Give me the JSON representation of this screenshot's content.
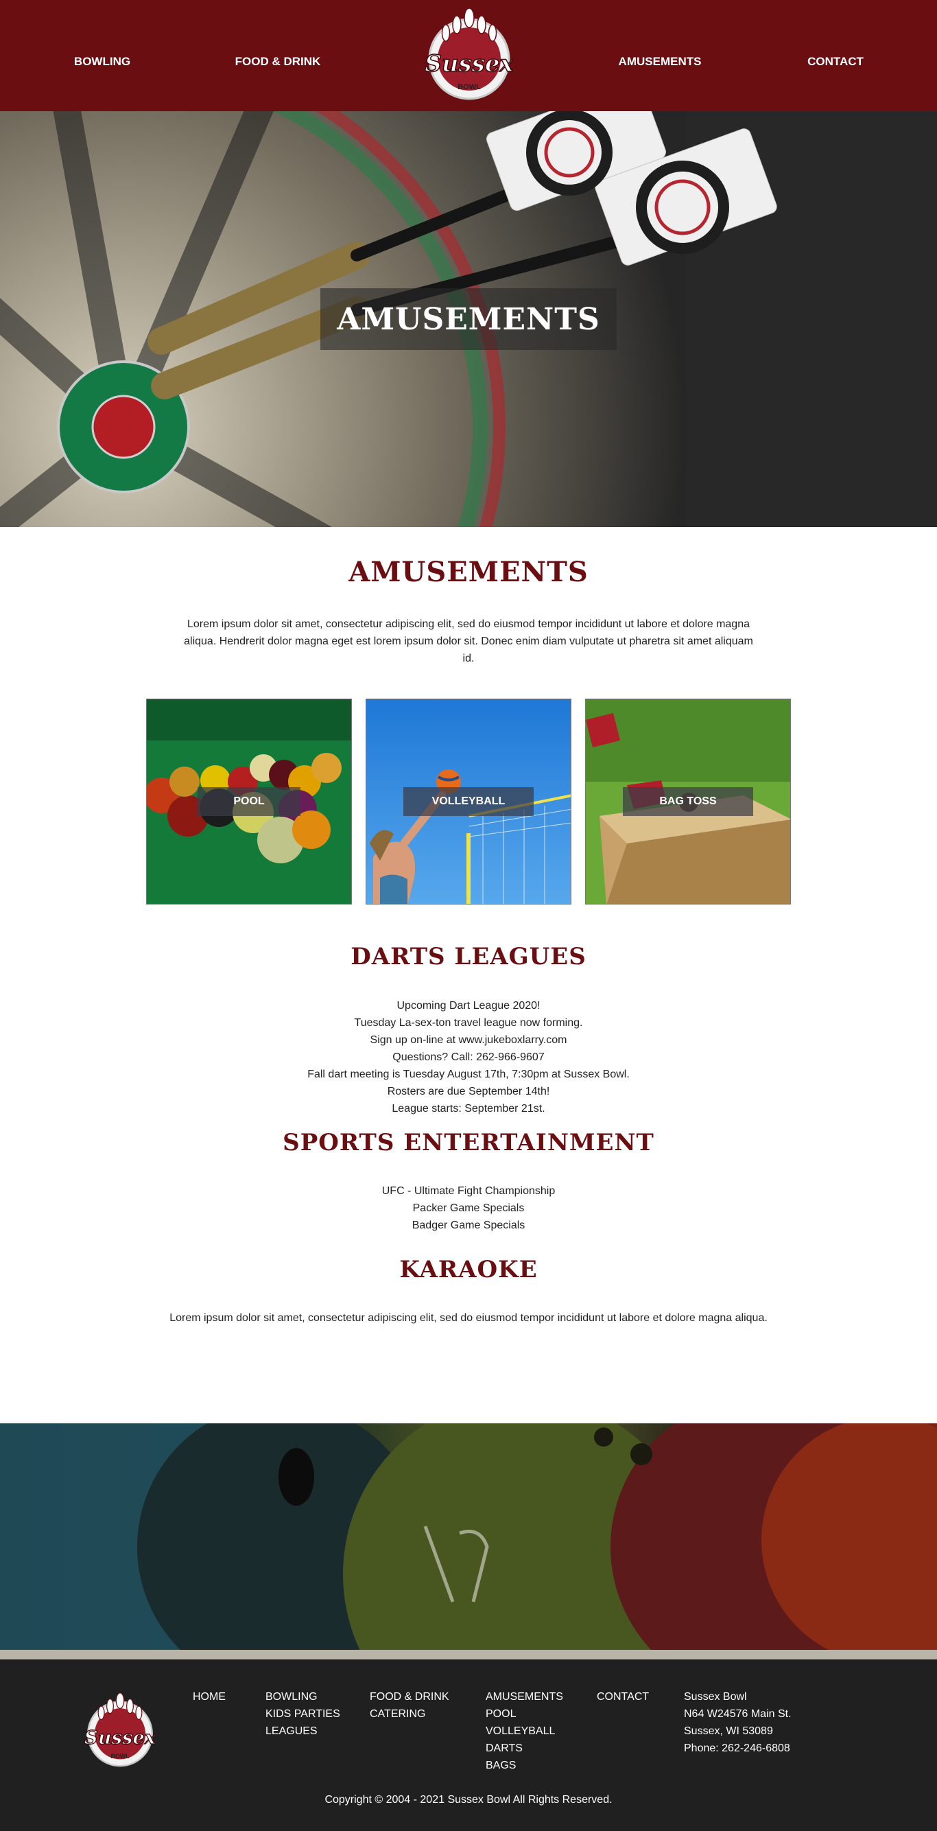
{
  "nav": {
    "bowling": "BOWLING",
    "food_drink": "FOOD & DRINK",
    "amusements": "AMUSEMENTS",
    "contact": "CONTACT"
  },
  "logo": {
    "name": "Sussex",
    "sub": "BOWL"
  },
  "hero": {
    "title": "AMUSEMENTS"
  },
  "intro": {
    "title": "AMUSEMENTS",
    "text": "Lorem ipsum dolor sit amet, consectetur adipiscing elit, sed do eiusmod tempor incididunt ut labore et dolore magna aliqua. Hendrerit dolor magna eget est lorem ipsum dolor sit. Donec enim diam vulputate ut pharetra sit amet aliquam id."
  },
  "tiles": [
    {
      "label": "POOL"
    },
    {
      "label": "VOLLEYBALL"
    },
    {
      "label": "BAG TOSS"
    }
  ],
  "darts": {
    "title": "DARTS LEAGUES",
    "lines": [
      "Upcoming Dart League 2020!",
      "Tuesday La-sex-ton travel league now forming.",
      "Sign up on-line at www.jukeboxlarry.com",
      "Questions? Call: 262-966-9607",
      "Fall dart meeting is Tuesday August 17th, 7:30pm at Sussex Bowl.",
      "Rosters are due September 14th!",
      "League starts: September 21st."
    ]
  },
  "sports": {
    "title": "SPORTS ENTERTAINMENT",
    "lines": [
      "UFC - Ultimate Fight Championship",
      "Packer Game Specials",
      "Badger Game Specials"
    ]
  },
  "karaoke": {
    "title": "KARAOKE",
    "text": "Lorem ipsum dolor sit amet, consectetur adipiscing elit, sed do eiusmod tempor incididunt ut labore et dolore magna aliqua."
  },
  "footer": {
    "home": [
      "HOME"
    ],
    "bowling": [
      "BOWLING",
      "KIDS PARTIES",
      "LEAGUES"
    ],
    "food": [
      "FOOD & DRINK",
      "CATERING"
    ],
    "amusements": [
      "AMUSEMENTS",
      "POOL",
      "VOLLEYBALL",
      "DARTS",
      "BAGS"
    ],
    "contact": [
      "CONTACT"
    ],
    "address": [
      "Sussex Bowl",
      "N64 W24576 Main St.",
      "Sussex, WI 53089",
      "Phone: 262-246-6808"
    ],
    "copyright": "Copyright © 2004 - 2021 Sussex Bowl All Rights Reserved."
  },
  "colors": {
    "brand": "#6b0e12",
    "footer": "#202020"
  }
}
